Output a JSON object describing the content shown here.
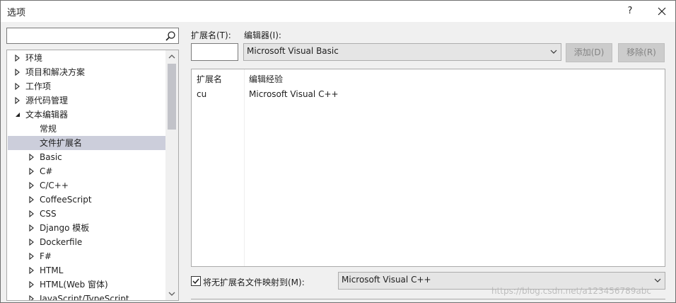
{
  "title": "选项",
  "titlebar": {
    "help_label": "?",
    "close_icon": "close-icon"
  },
  "search": {
    "value": "",
    "placeholder": ""
  },
  "tree": {
    "items": [
      {
        "label": "环境",
        "expander": "collapsed"
      },
      {
        "label": "项目和解决方案",
        "expander": "collapsed"
      },
      {
        "label": "工作项",
        "expander": "collapsed"
      },
      {
        "label": "源代码管理",
        "expander": "collapsed"
      },
      {
        "label": "文本编辑器",
        "expander": "expanded"
      },
      {
        "label": "常规",
        "expander": "none"
      },
      {
        "label": "文件扩展名",
        "expander": "none",
        "selected": true
      },
      {
        "label": "Basic",
        "expander": "collapsed"
      },
      {
        "label": "C#",
        "expander": "collapsed"
      },
      {
        "label": "C/C++",
        "expander": "collapsed"
      },
      {
        "label": "CoffeeScript",
        "expander": "collapsed"
      },
      {
        "label": "CSS",
        "expander": "collapsed"
      },
      {
        "label": "Django 模板",
        "expander": "collapsed"
      },
      {
        "label": "Dockerfile",
        "expander": "collapsed"
      },
      {
        "label": "F#",
        "expander": "collapsed"
      },
      {
        "label": "HTML",
        "expander": "collapsed"
      },
      {
        "label": "HTML(Web 窗体)",
        "expander": "collapsed"
      },
      {
        "label": "JavaScript/TypeScript",
        "expander": "collapsed"
      }
    ]
  },
  "extension": {
    "label": "扩展名(T):",
    "value": ""
  },
  "editor": {
    "label": "编辑器(I):",
    "value": "Microsoft Visual Basic"
  },
  "buttons": {
    "add": "添加(D)",
    "remove": "移除(R)"
  },
  "grid": {
    "columns": [
      "扩展名",
      "编辑经验"
    ],
    "rows": [
      {
        "ext": "cu",
        "editor": "Microsoft Visual C++"
      }
    ]
  },
  "map_no_ext": {
    "label": "将无扩展名文件映射到(M):",
    "checked": true,
    "value": "Microsoft Visual C++"
  },
  "watermark": "https://blog.csdn.net/a123456789abc",
  "colors": {
    "selected_bg": "#cccedb",
    "dialog_bg": "#f0f0f0",
    "disabled_btn": "#cccccc"
  }
}
